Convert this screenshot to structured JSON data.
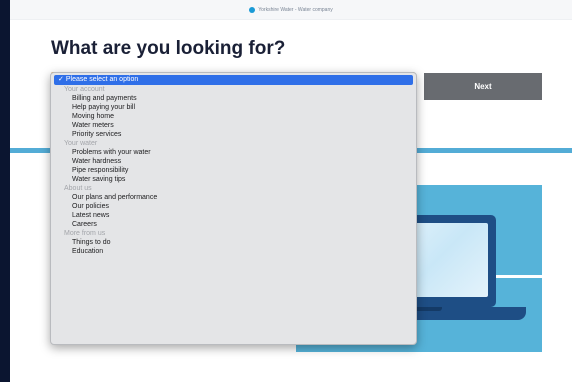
{
  "topbar": {
    "site": "Yorkshire Water - Water company"
  },
  "heading": "What are you looking for?",
  "next_button": "Next",
  "dropdown": {
    "selected_check": "✓",
    "selected_label": "Please select an option",
    "groups": [
      {
        "label": "Your account",
        "items": [
          "Billing and payments",
          "Help paying your bill",
          "Moving home",
          "Water meters",
          "Priority services"
        ]
      },
      {
        "label": "Your water",
        "items": [
          "Problems with your water",
          "Water hardness",
          "Pipe responsibility",
          "Water saving tips"
        ]
      },
      {
        "label": "About us",
        "items": [
          "Our plans and performance",
          "Our policies",
          "Latest news",
          "Careers"
        ]
      },
      {
        "label": "More from us",
        "items": [
          "Things to do",
          "Education"
        ]
      }
    ]
  },
  "colors": {
    "frame": "#0b1530",
    "accent_blue": "#53acd6",
    "select_focus": "#e8a63a",
    "selected_option": "#2f6fe8",
    "next_button": "#686b70"
  }
}
